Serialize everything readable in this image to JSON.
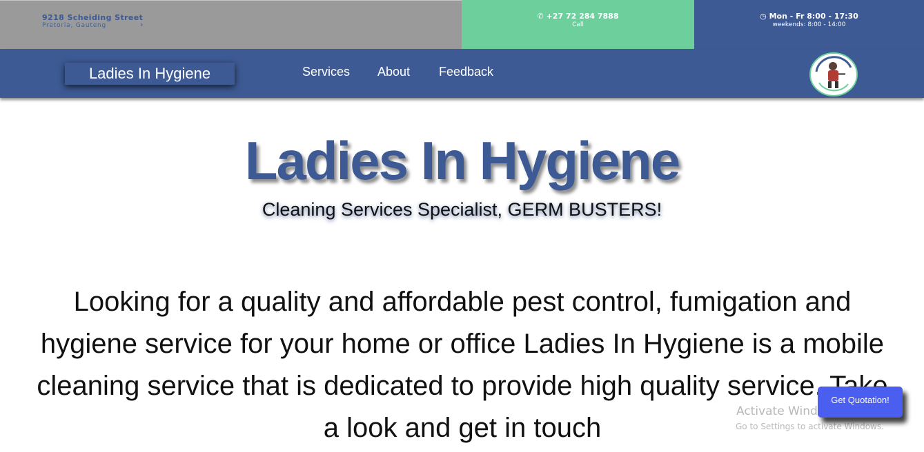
{
  "topbar": {
    "address_street": "9218 Scheiding Street",
    "address_city": "Pretoria, Gauteng",
    "phone_icon": "phone-icon",
    "phone_number": "+27 72 284 7888",
    "phone_label": "Call",
    "clock_icon": "clock-icon",
    "hours_main": "Mon - Fr 8:00 - 17:30",
    "hours_weekend": "weekends: 8:00 - 14:00"
  },
  "nav": {
    "brand": "Ladies In Hygiene",
    "links": [
      "Services",
      "About",
      "Feedback"
    ],
    "logo_text": "Ladies In Hygiene"
  },
  "hero": {
    "title": "Ladies In Hygiene",
    "subtitle": "Cleaning Services Specialist, GERM BUSTERS!",
    "intro": "Looking for a quality and affordable pest control, fumigation and hygiene service for your home or office Ladies In Hygiene is a mobile cleaning service that is dedicated to provide high quality service. Take a look and get in touch"
  },
  "overlay": {
    "watermark_title": "Activate Windows",
    "watermark_sub": "Go to Settings to activate Windows.",
    "quote_button": "Get Quotation!"
  },
  "colors": {
    "brand_blue": "#3d5a94",
    "address_gray": "#9a9a9a",
    "phone_green": "#6ccf9c",
    "quote_button": "#4a5ef0"
  }
}
